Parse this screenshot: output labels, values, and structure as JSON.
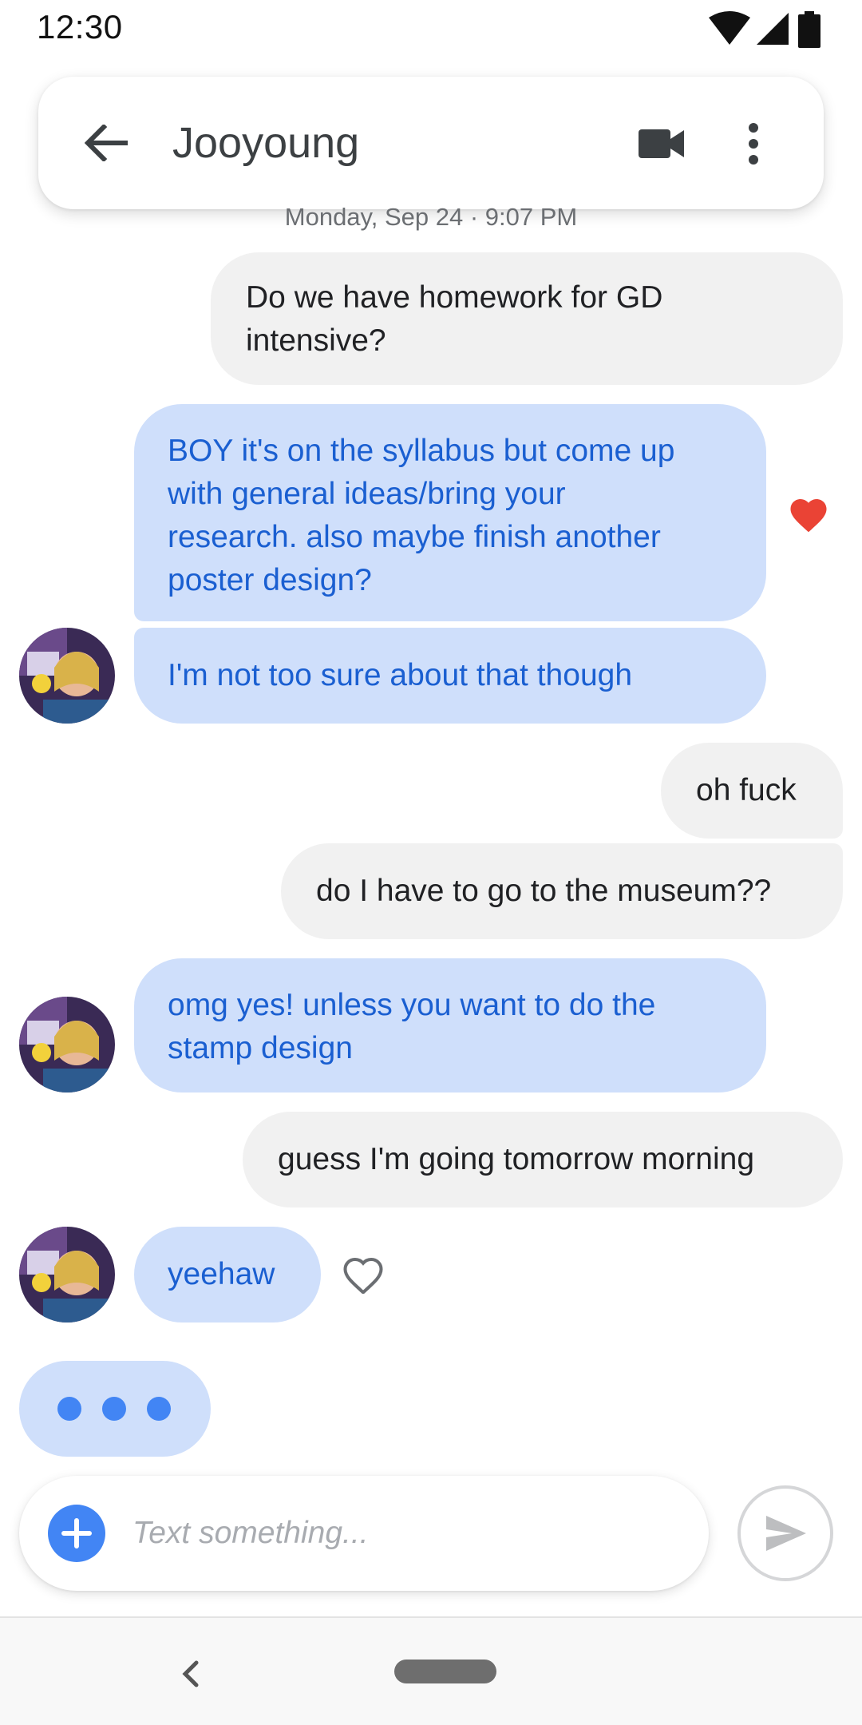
{
  "status_bar": {
    "time": "12:30",
    "icons": [
      "wifi-icon",
      "cell-signal-icon",
      "battery-icon"
    ]
  },
  "header": {
    "contact_name": "Jooyoung",
    "icons": [
      "back-arrow-icon",
      "video-call-icon",
      "more-vert-icon"
    ]
  },
  "date_stamp": "Monday, Sep 24 · 9:07 PM",
  "messages": [
    {
      "direction": "outgoing",
      "lines": [
        "Do we have homework for GD",
        "intensive?"
      ]
    },
    {
      "direction": "incoming",
      "lines": [
        "BOY it's on the syllabus but come up",
        "with general ideas/bring your",
        "research. also maybe finish another",
        "poster design?"
      ],
      "reaction": "heart-filled-icon"
    },
    {
      "direction": "incoming",
      "lines": [
        "I'm not too sure about that though"
      ]
    },
    {
      "direction": "outgoing",
      "lines": [
        "oh fuck"
      ]
    },
    {
      "direction": "outgoing",
      "lines": [
        "do I have to go to the museum??"
      ]
    },
    {
      "direction": "incoming",
      "lines": [
        "omg yes! unless you want to do the",
        "stamp design"
      ]
    },
    {
      "direction": "outgoing",
      "lines": [
        "guess I'm going tomorrow morning"
      ]
    },
    {
      "direction": "incoming",
      "lines": [
        "yeehaw"
      ],
      "reaction": "heart-outline-icon"
    }
  ],
  "typing_indicator": true,
  "compose": {
    "placeholder": "Text something...",
    "icons": [
      "add-icon",
      "send-icon"
    ]
  },
  "colors": {
    "incoming_bubble": "#cfdffb",
    "incoming_text": "#1a5fd1",
    "outgoing_bubble": "#f1f1f1",
    "accent": "#4285f4",
    "heart": "#ea4335"
  }
}
